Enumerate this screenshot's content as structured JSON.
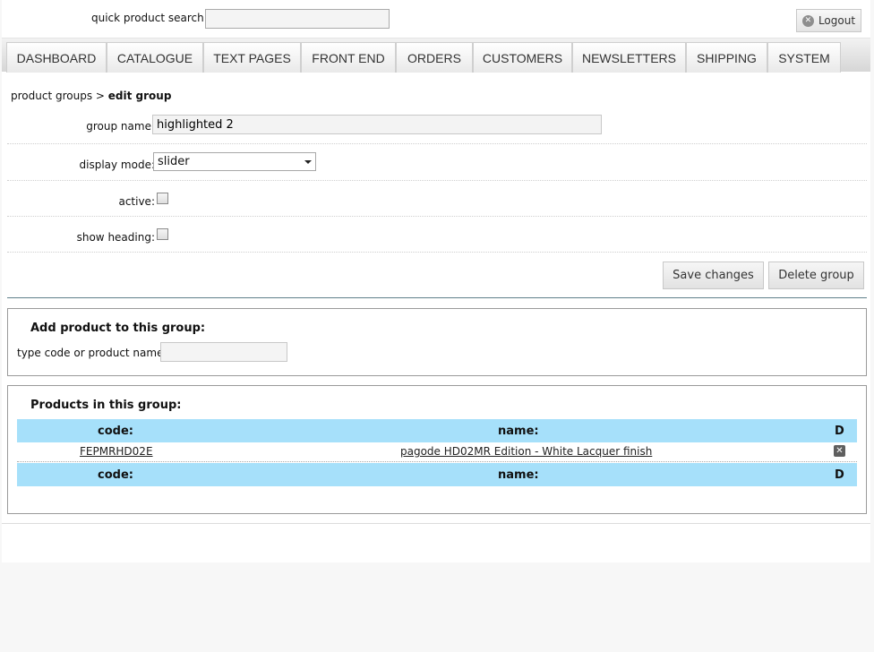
{
  "header": {
    "search_label": "quick product search:",
    "search_value": "",
    "logout_label": "Logout"
  },
  "nav": {
    "tabs": [
      {
        "label": "DASHBOARD"
      },
      {
        "label": "CATALOGUE"
      },
      {
        "label": "TEXT PAGES"
      },
      {
        "label": "FRONT END"
      },
      {
        "label": "ORDERS"
      },
      {
        "label": "CUSTOMERS"
      },
      {
        "label": "NEWSLETTERS"
      },
      {
        "label": "SHIPPING"
      },
      {
        "label": "SYSTEM"
      }
    ]
  },
  "breadcrumb": {
    "parent": "product groups",
    "separator": ">",
    "current": "edit group"
  },
  "form": {
    "group_name_label": "group name:",
    "group_name_value": "highlighted 2",
    "display_mode_label": "display mode:",
    "display_mode_value": "slider",
    "active_label": "active:",
    "active_checked": false,
    "show_heading_label": "show heading:",
    "show_heading_checked": false,
    "save_label": "Save changes",
    "delete_label": "Delete group"
  },
  "add_panel": {
    "title": "Add product to this group:",
    "input_label": "type code or product name:",
    "input_value": ""
  },
  "products_panel": {
    "title": "Products in this group:",
    "columns": {
      "code": "code:",
      "name": "name:",
      "delete": "D"
    },
    "rows": [
      {
        "code": "FEPMRHD02E",
        "name": "pagode HD02MR Edition - White Lacquer finish"
      }
    ]
  },
  "icons": {
    "logout": "close-circle-icon",
    "delete_row": "delete-x-icon"
  },
  "colors": {
    "table_header": "#a6e0fa",
    "divider": "#5f7f8a"
  }
}
